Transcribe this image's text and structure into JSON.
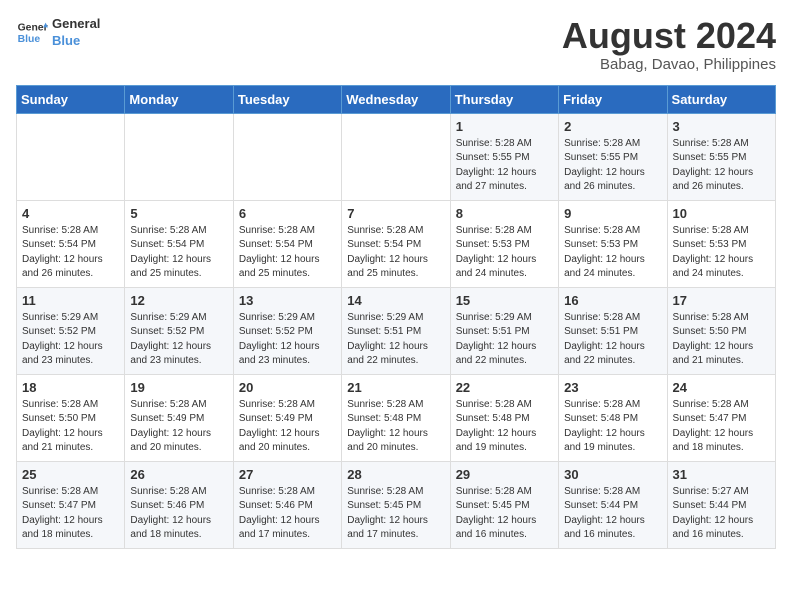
{
  "header": {
    "logo_line1": "General",
    "logo_line2": "Blue",
    "title": "August 2024",
    "subtitle": "Babag, Davao, Philippines"
  },
  "weekdays": [
    "Sunday",
    "Monday",
    "Tuesday",
    "Wednesday",
    "Thursday",
    "Friday",
    "Saturday"
  ],
  "weeks": [
    [
      {
        "day": "",
        "info": ""
      },
      {
        "day": "",
        "info": ""
      },
      {
        "day": "",
        "info": ""
      },
      {
        "day": "",
        "info": ""
      },
      {
        "day": "1",
        "info": "Sunrise: 5:28 AM\nSunset: 5:55 PM\nDaylight: 12 hours\nand 27 minutes."
      },
      {
        "day": "2",
        "info": "Sunrise: 5:28 AM\nSunset: 5:55 PM\nDaylight: 12 hours\nand 26 minutes."
      },
      {
        "day": "3",
        "info": "Sunrise: 5:28 AM\nSunset: 5:55 PM\nDaylight: 12 hours\nand 26 minutes."
      }
    ],
    [
      {
        "day": "4",
        "info": "Sunrise: 5:28 AM\nSunset: 5:54 PM\nDaylight: 12 hours\nand 26 minutes."
      },
      {
        "day": "5",
        "info": "Sunrise: 5:28 AM\nSunset: 5:54 PM\nDaylight: 12 hours\nand 25 minutes."
      },
      {
        "day": "6",
        "info": "Sunrise: 5:28 AM\nSunset: 5:54 PM\nDaylight: 12 hours\nand 25 minutes."
      },
      {
        "day": "7",
        "info": "Sunrise: 5:28 AM\nSunset: 5:54 PM\nDaylight: 12 hours\nand 25 minutes."
      },
      {
        "day": "8",
        "info": "Sunrise: 5:28 AM\nSunset: 5:53 PM\nDaylight: 12 hours\nand 24 minutes."
      },
      {
        "day": "9",
        "info": "Sunrise: 5:28 AM\nSunset: 5:53 PM\nDaylight: 12 hours\nand 24 minutes."
      },
      {
        "day": "10",
        "info": "Sunrise: 5:28 AM\nSunset: 5:53 PM\nDaylight: 12 hours\nand 24 minutes."
      }
    ],
    [
      {
        "day": "11",
        "info": "Sunrise: 5:29 AM\nSunset: 5:52 PM\nDaylight: 12 hours\nand 23 minutes."
      },
      {
        "day": "12",
        "info": "Sunrise: 5:29 AM\nSunset: 5:52 PM\nDaylight: 12 hours\nand 23 minutes."
      },
      {
        "day": "13",
        "info": "Sunrise: 5:29 AM\nSunset: 5:52 PM\nDaylight: 12 hours\nand 23 minutes."
      },
      {
        "day": "14",
        "info": "Sunrise: 5:29 AM\nSunset: 5:51 PM\nDaylight: 12 hours\nand 22 minutes."
      },
      {
        "day": "15",
        "info": "Sunrise: 5:29 AM\nSunset: 5:51 PM\nDaylight: 12 hours\nand 22 minutes."
      },
      {
        "day": "16",
        "info": "Sunrise: 5:28 AM\nSunset: 5:51 PM\nDaylight: 12 hours\nand 22 minutes."
      },
      {
        "day": "17",
        "info": "Sunrise: 5:28 AM\nSunset: 5:50 PM\nDaylight: 12 hours\nand 21 minutes."
      }
    ],
    [
      {
        "day": "18",
        "info": "Sunrise: 5:28 AM\nSunset: 5:50 PM\nDaylight: 12 hours\nand 21 minutes."
      },
      {
        "day": "19",
        "info": "Sunrise: 5:28 AM\nSunset: 5:49 PM\nDaylight: 12 hours\nand 20 minutes."
      },
      {
        "day": "20",
        "info": "Sunrise: 5:28 AM\nSunset: 5:49 PM\nDaylight: 12 hours\nand 20 minutes."
      },
      {
        "day": "21",
        "info": "Sunrise: 5:28 AM\nSunset: 5:48 PM\nDaylight: 12 hours\nand 20 minutes."
      },
      {
        "day": "22",
        "info": "Sunrise: 5:28 AM\nSunset: 5:48 PM\nDaylight: 12 hours\nand 19 minutes."
      },
      {
        "day": "23",
        "info": "Sunrise: 5:28 AM\nSunset: 5:48 PM\nDaylight: 12 hours\nand 19 minutes."
      },
      {
        "day": "24",
        "info": "Sunrise: 5:28 AM\nSunset: 5:47 PM\nDaylight: 12 hours\nand 18 minutes."
      }
    ],
    [
      {
        "day": "25",
        "info": "Sunrise: 5:28 AM\nSunset: 5:47 PM\nDaylight: 12 hours\nand 18 minutes."
      },
      {
        "day": "26",
        "info": "Sunrise: 5:28 AM\nSunset: 5:46 PM\nDaylight: 12 hours\nand 18 minutes."
      },
      {
        "day": "27",
        "info": "Sunrise: 5:28 AM\nSunset: 5:46 PM\nDaylight: 12 hours\nand 17 minutes."
      },
      {
        "day": "28",
        "info": "Sunrise: 5:28 AM\nSunset: 5:45 PM\nDaylight: 12 hours\nand 17 minutes."
      },
      {
        "day": "29",
        "info": "Sunrise: 5:28 AM\nSunset: 5:45 PM\nDaylight: 12 hours\nand 16 minutes."
      },
      {
        "day": "30",
        "info": "Sunrise: 5:28 AM\nSunset: 5:44 PM\nDaylight: 12 hours\nand 16 minutes."
      },
      {
        "day": "31",
        "info": "Sunrise: 5:27 AM\nSunset: 5:44 PM\nDaylight: 12 hours\nand 16 minutes."
      }
    ]
  ]
}
